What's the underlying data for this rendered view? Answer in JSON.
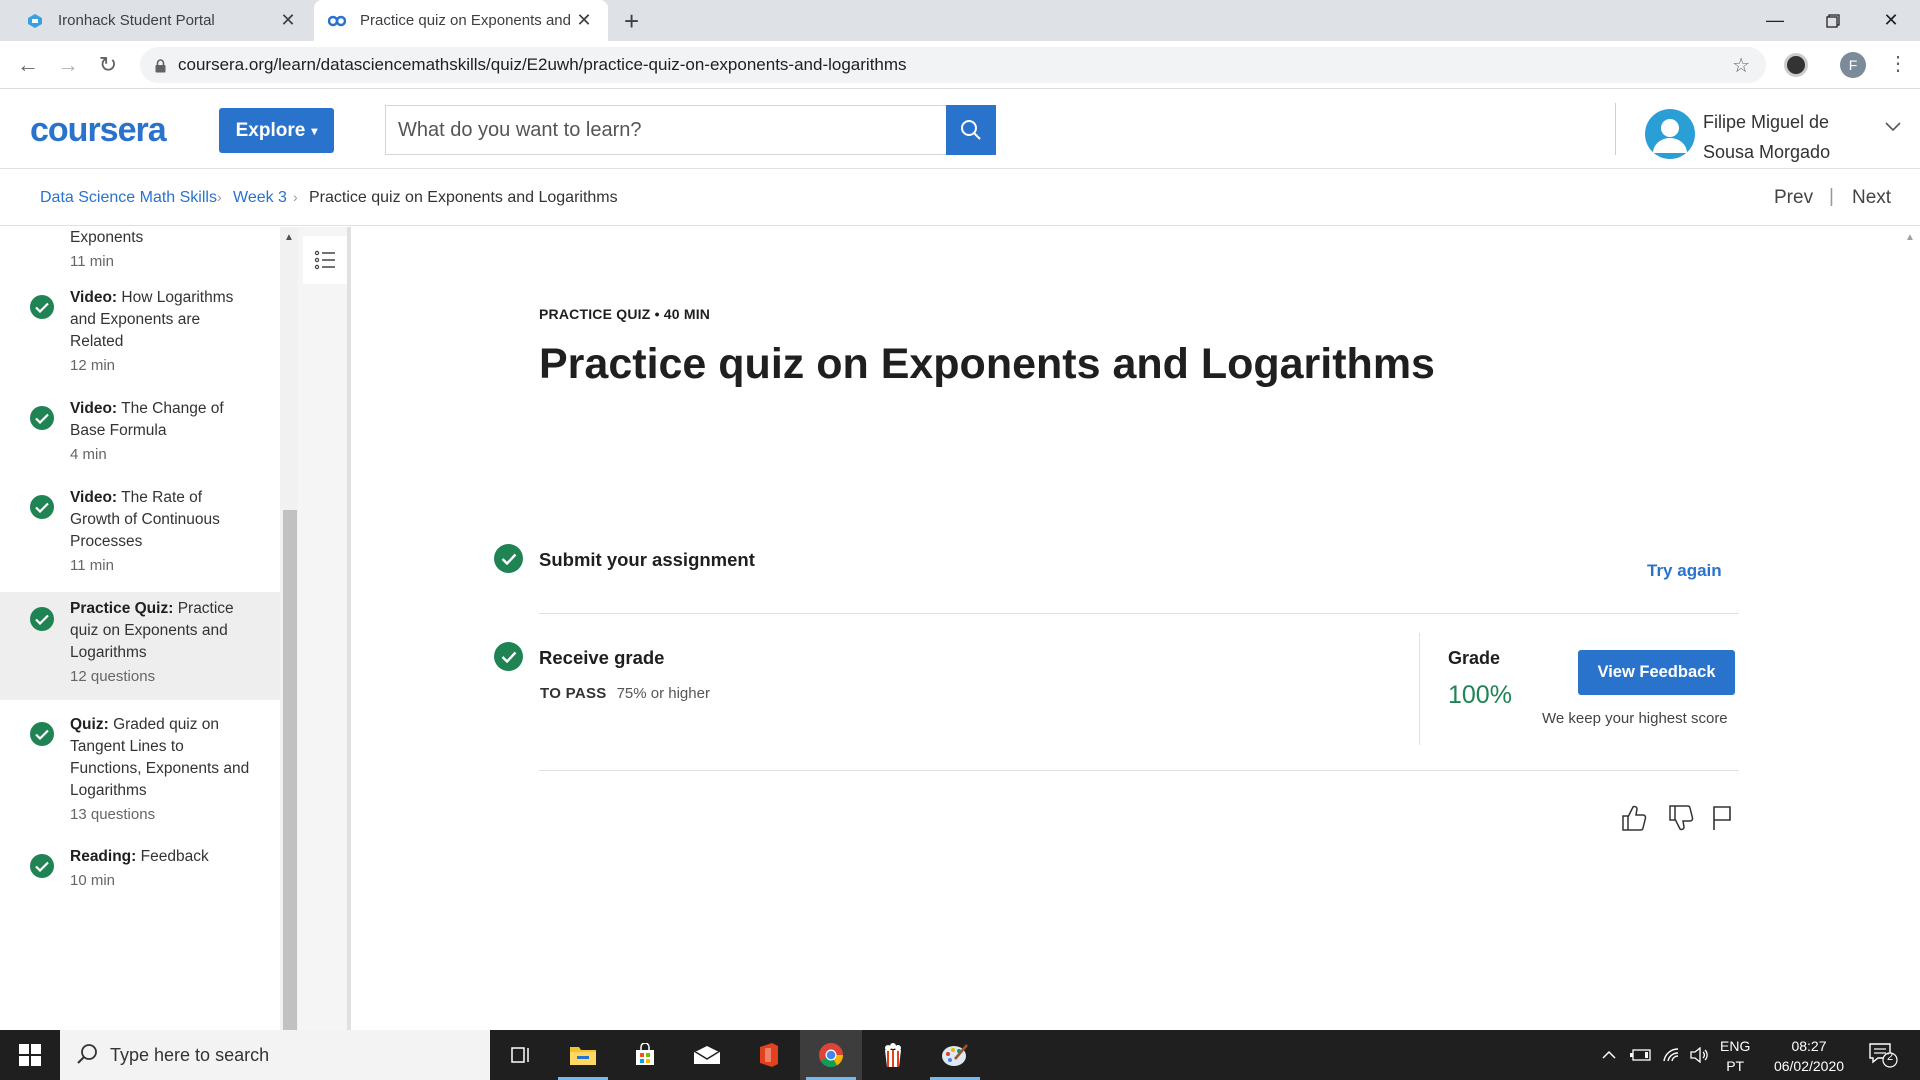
{
  "browser": {
    "tabs": [
      {
        "title": "Ironhack Student Portal",
        "active": false
      },
      {
        "title": "Practice quiz on Exponents and L",
        "active": true
      }
    ],
    "new_tab": "+",
    "url": "coursera.org/learn/datasciencemathskills/quiz/E2uwh/practice-quiz-on-exponents-and-logarithms",
    "profile_initial": "F"
  },
  "header": {
    "logo": "coursera",
    "explore_label": "Explore",
    "search_placeholder": "What do you want to learn?",
    "user_name_line1": "Filipe Miguel de",
    "user_name_line2": "Sousa Morgado"
  },
  "breadcrumb": {
    "items": [
      "Data Science Math Skills",
      "Week 3",
      "Practice quiz on Exponents and Logarithms"
    ],
    "prev": "Prev",
    "next": "Next",
    "sep": "|"
  },
  "sidebar": {
    "partial_item": {
      "title": "Exponents",
      "duration": "11 min"
    },
    "items": [
      {
        "type": "Video:",
        "title": "How Logarithms and Exponents are Related",
        "duration": "12 min",
        "active": false
      },
      {
        "type": "Video:",
        "title": "The Change of Base Formula",
        "duration": "4 min",
        "active": false
      },
      {
        "type": "Video:",
        "title": "The Rate of Growth of Continuous Processes",
        "duration": "11 min",
        "active": false
      },
      {
        "type": "Practice Quiz:",
        "title": "Practice quiz on Exponents and Logarithms",
        "duration": "12 questions",
        "active": true
      },
      {
        "type": "Quiz:",
        "title": "Graded quiz on Tangent Lines to Functions, Exponents and Logarithms",
        "duration": "13 questions",
        "active": false
      },
      {
        "type": "Reading:",
        "title": "Feedback",
        "duration": "10 min",
        "active": false
      }
    ]
  },
  "main": {
    "kicker": "PRACTICE QUIZ • 40 MIN",
    "title": "Practice quiz on Exponents and Logarithms",
    "step1": {
      "title": "Submit your assignment",
      "action": "Try again"
    },
    "step2": {
      "title": "Receive grade",
      "to_pass_label": "TO PASS",
      "to_pass_value": "75% or higher",
      "grade_label": "Grade",
      "grade_value": "100%",
      "view_feedback": "View Feedback",
      "keep_note": "We keep your highest score"
    }
  },
  "taskbar": {
    "search_placeholder": "Type here to search",
    "lang_line1": "ENG",
    "lang_line2": "PT",
    "time": "08:27",
    "date": "06/02/2020",
    "notif_count": "2"
  },
  "colors": {
    "brand_blue": "#2a73cc",
    "success_green": "#1f8354"
  }
}
